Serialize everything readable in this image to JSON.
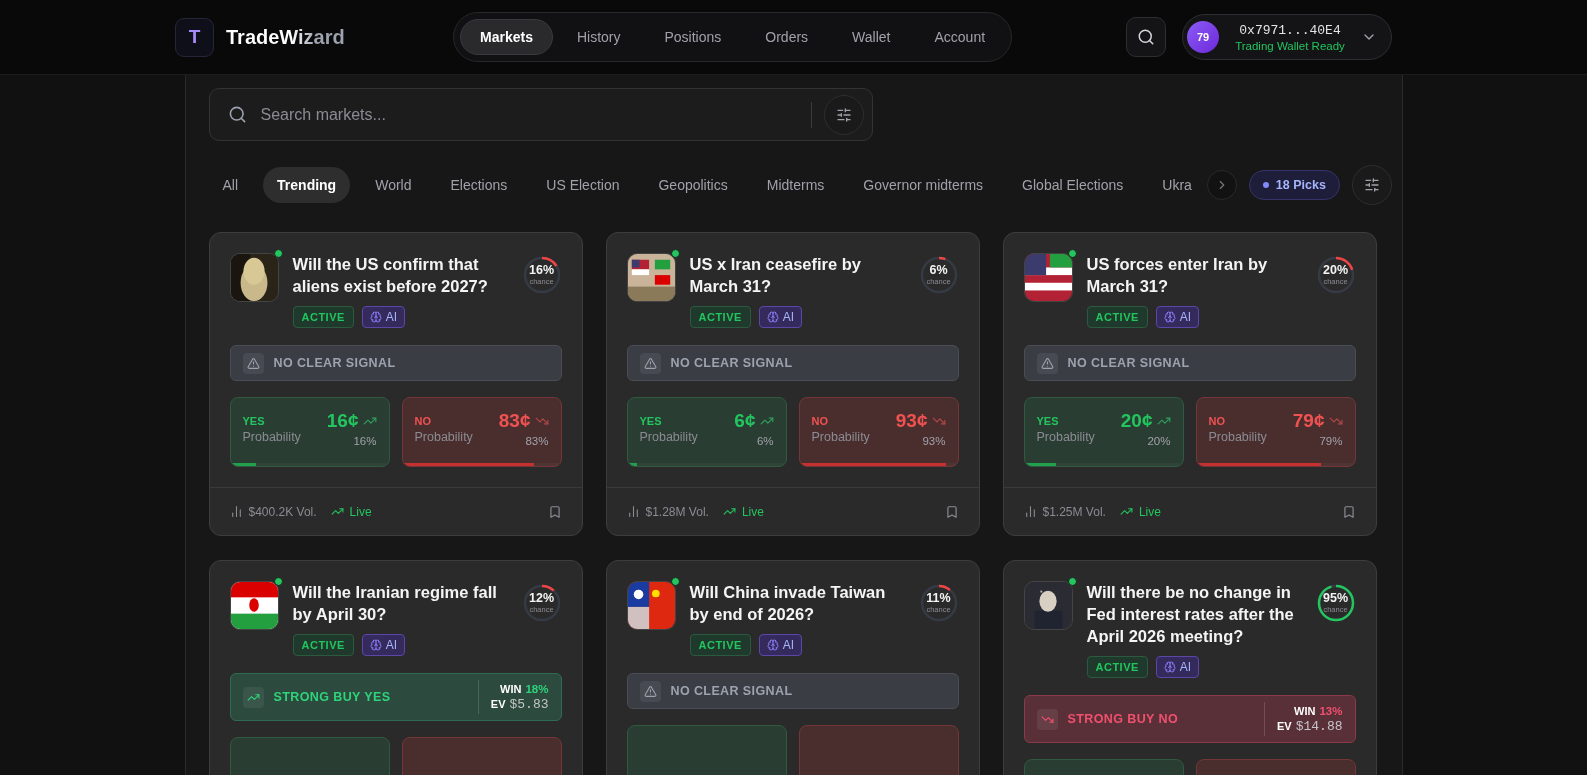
{
  "brand": {
    "logo_letter": "T",
    "name": "TradeWizard"
  },
  "nav": [
    {
      "label": "Markets",
      "selected": true
    },
    {
      "label": "History",
      "selected": false
    },
    {
      "label": "Positions",
      "selected": false
    },
    {
      "label": "Orders",
      "selected": false
    },
    {
      "label": "Wallet",
      "selected": false
    },
    {
      "label": "Account",
      "selected": false
    }
  ],
  "wallet": {
    "avatar": "79",
    "address": "0x7971...40E4",
    "status": "Trading Wallet Ready"
  },
  "search": {
    "placeholder": "Search markets..."
  },
  "categories": [
    {
      "label": "All",
      "selected": false
    },
    {
      "label": "Trending",
      "selected": true
    },
    {
      "label": "World",
      "selected": false
    },
    {
      "label": "Elections",
      "selected": false
    },
    {
      "label": "US Election",
      "selected": false
    },
    {
      "label": "Geopolitics",
      "selected": false
    },
    {
      "label": "Midterms",
      "selected": false
    },
    {
      "label": "Governor midterms",
      "selected": false
    },
    {
      "label": "Global Elections",
      "selected": false
    },
    {
      "label": "Ukra",
      "selected": false
    }
  ],
  "picks": "18 Picks",
  "cards": [
    {
      "title": "Will the US confirm that aliens exist before 2027?",
      "online": true,
      "chance": "16%",
      "chance_label": "chance",
      "level": 0.16,
      "badges": [
        {
          "kind": "status",
          "label": "ACTIVE"
        },
        {
          "kind": "ai",
          "label": "AI"
        }
      ],
      "signal": {
        "kind": "none",
        "label": "NO CLEAR SIGNAL"
      },
      "prices": [
        {
          "kind": "yes",
          "label": "YES",
          "sub": "Probability",
          "price": "16¢",
          "percent": "16%",
          "level": 0.16
        },
        {
          "kind": "no",
          "label": "NO",
          "sub": "Probability",
          "price": "83¢",
          "percent": "83%",
          "level": 0.83
        }
      ],
      "volume": "$400.2K Vol.",
      "live": "Live"
    },
    {
      "title": "US x Iran ceasefire by March 31?",
      "online": true,
      "chance": "6%",
      "chance_label": "chance",
      "level": 0.06,
      "badges": [
        {
          "kind": "status",
          "label": "ACTIVE"
        },
        {
          "kind": "ai",
          "label": "AI"
        }
      ],
      "signal": {
        "kind": "none",
        "label": "NO CLEAR SIGNAL"
      },
      "prices": [
        {
          "kind": "yes",
          "label": "YES",
          "sub": "Probability",
          "price": "6¢",
          "percent": "6%",
          "level": 0.06
        },
        {
          "kind": "no",
          "label": "NO",
          "sub": "Probability",
          "price": "93¢",
          "percent": "93%",
          "level": 0.93
        }
      ],
      "volume": "$1.28M Vol.",
      "live": "Live"
    },
    {
      "title": "US forces enter Iran by March 31?",
      "online": true,
      "chance": "20%",
      "chance_label": "chance",
      "level": 0.2,
      "badges": [
        {
          "kind": "status",
          "label": "ACTIVE"
        },
        {
          "kind": "ai",
          "label": "AI"
        }
      ],
      "signal": {
        "kind": "none",
        "label": "NO CLEAR SIGNAL"
      },
      "prices": [
        {
          "kind": "yes",
          "label": "YES",
          "sub": "Probability",
          "price": "20¢",
          "percent": "20%",
          "level": 0.2
        },
        {
          "kind": "no",
          "label": "NO",
          "sub": "Probability",
          "price": "79¢",
          "percent": "79%",
          "level": 0.79
        }
      ],
      "volume": "$1.25M Vol.",
      "live": "Live"
    },
    {
      "title": "Will the Iranian regime fall by April 30?",
      "online": true,
      "chance": "12%",
      "chance_label": "chance",
      "level": 0.12,
      "badges": [
        {
          "kind": "status",
          "label": "ACTIVE"
        },
        {
          "kind": "ai",
          "label": "AI"
        }
      ],
      "signal": {
        "kind": "buy_yes",
        "label": "STRONG BUY YES",
        "win_label": "WIN",
        "win": "18%",
        "ev_label": "EV",
        "ev": "$5.83"
      },
      "prices": [
        {
          "kind": "yes"
        },
        {
          "kind": "no"
        }
      ]
    },
    {
      "title": "Will China invade Taiwan by end of 2026?",
      "online": true,
      "chance": "11%",
      "chance_label": "chance",
      "level": 0.11,
      "badges": [
        {
          "kind": "status",
          "label": "ACTIVE"
        },
        {
          "kind": "ai",
          "label": "AI"
        }
      ],
      "signal": {
        "kind": "none",
        "label": "NO CLEAR SIGNAL"
      },
      "prices": [
        {
          "kind": "yes"
        },
        {
          "kind": "no"
        }
      ]
    },
    {
      "title": "Will there be no change in Fed interest rates after the April 2026 meeting?",
      "online": true,
      "chance": "95%",
      "chance_label": "chance",
      "level": 0.95,
      "badges": [
        {
          "kind": "status",
          "label": "ACTIVE"
        },
        {
          "kind": "ai",
          "label": "AI"
        }
      ],
      "signal": {
        "kind": "buy_no",
        "label": "STRONG BUY NO",
        "win_label": "WIN",
        "win": "13%",
        "ev_label": "EV",
        "ev": "$14.88"
      },
      "prices": [
        {
          "kind": "yes"
        },
        {
          "kind": "no"
        }
      ]
    }
  ]
}
